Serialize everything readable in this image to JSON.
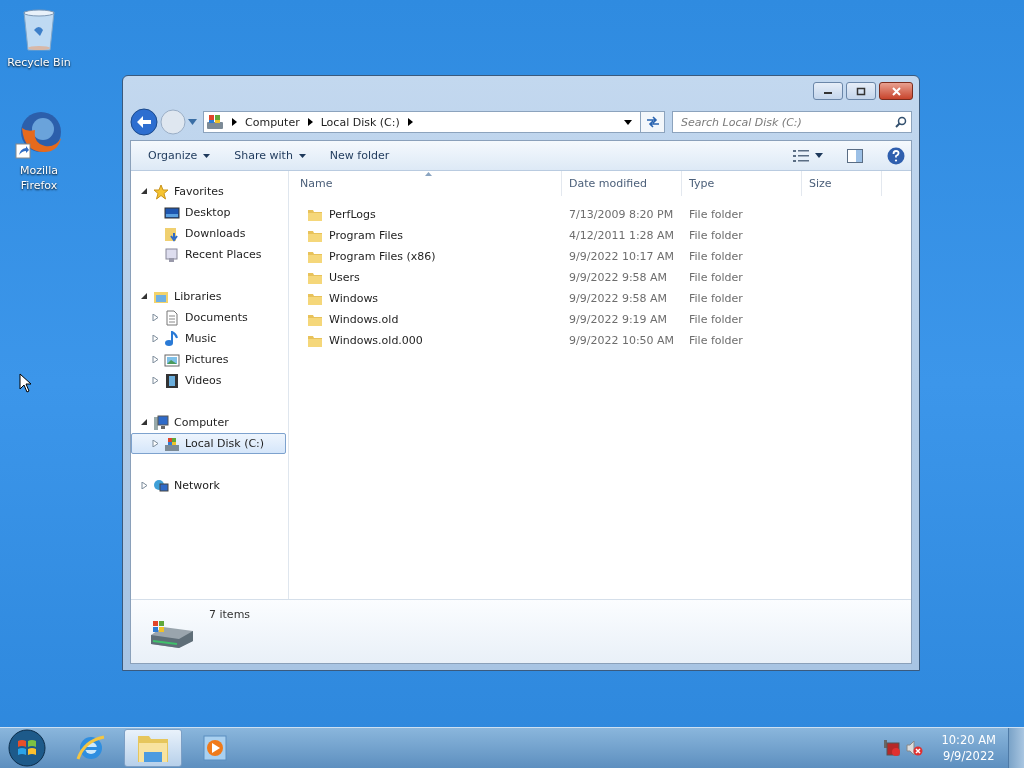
{
  "desktop_icons": [
    {
      "label": "Recycle Bin"
    },
    {
      "label": "Mozilla Firefox"
    }
  ],
  "window": {
    "address": {
      "segments": [
        "Computer",
        "Local Disk (C:)"
      ]
    },
    "search": {
      "placeholder": "Search Local Disk (C:)"
    },
    "toolbar": [
      {
        "label": "Organize",
        "dropdown": true
      },
      {
        "label": "Share with",
        "dropdown": true
      },
      {
        "label": "New folder",
        "dropdown": false
      }
    ],
    "nav": [
      {
        "label": "Favorites",
        "expanded": true,
        "selected": false,
        "children": [
          {
            "label": "Desktop",
            "selected": false
          },
          {
            "label": "Downloads",
            "selected": false
          },
          {
            "label": "Recent Places",
            "selected": false
          }
        ]
      },
      {
        "label": "Libraries",
        "expanded": true,
        "selected": false,
        "children": [
          {
            "label": "Documents",
            "expanded": false,
            "selected": false
          },
          {
            "label": "Music",
            "expanded": false,
            "selected": false
          },
          {
            "label": "Pictures",
            "expanded": false,
            "selected": false
          },
          {
            "label": "Videos",
            "expanded": false,
            "selected": false
          }
        ]
      },
      {
        "label": "Computer",
        "expanded": true,
        "selected": false,
        "children": [
          {
            "label": "Local Disk (C:)",
            "expanded": false,
            "selected": true
          }
        ]
      },
      {
        "label": "Network",
        "expanded": false,
        "selected": false
      }
    ],
    "columns": [
      {
        "label": "Name",
        "sorted": true
      },
      {
        "label": "Date modified",
        "sorted": false
      },
      {
        "label": "Type",
        "sorted": false
      },
      {
        "label": "Size",
        "sorted": false
      }
    ],
    "files": [
      {
        "name": "PerfLogs",
        "date": "7/13/2009 8:20 PM",
        "type": "File folder"
      },
      {
        "name": "Program Files",
        "date": "4/12/2011 1:28 AM",
        "type": "File folder"
      },
      {
        "name": "Program Files (x86)",
        "date": "9/9/2022 10:17 AM",
        "type": "File folder"
      },
      {
        "name": "Users",
        "date": "9/9/2022 9:58 AM",
        "type": "File folder"
      },
      {
        "name": "Windows",
        "date": "9/9/2022 9:58 AM",
        "type": "File folder"
      },
      {
        "name": "Windows.old",
        "date": "9/9/2022 9:19 AM",
        "type": "File folder"
      },
      {
        "name": "Windows.old.000",
        "date": "9/9/2022 10:50 AM",
        "type": "File folder"
      }
    ],
    "status": {
      "count": "7 items"
    }
  },
  "taskbar": {
    "apps": [
      {
        "kind": "browser",
        "active": false
      },
      {
        "kind": "explorer",
        "active": true
      },
      {
        "kind": "media",
        "active": false
      }
    ],
    "clock": {
      "time": "10:20 AM",
      "date": "9/9/2022"
    }
  }
}
